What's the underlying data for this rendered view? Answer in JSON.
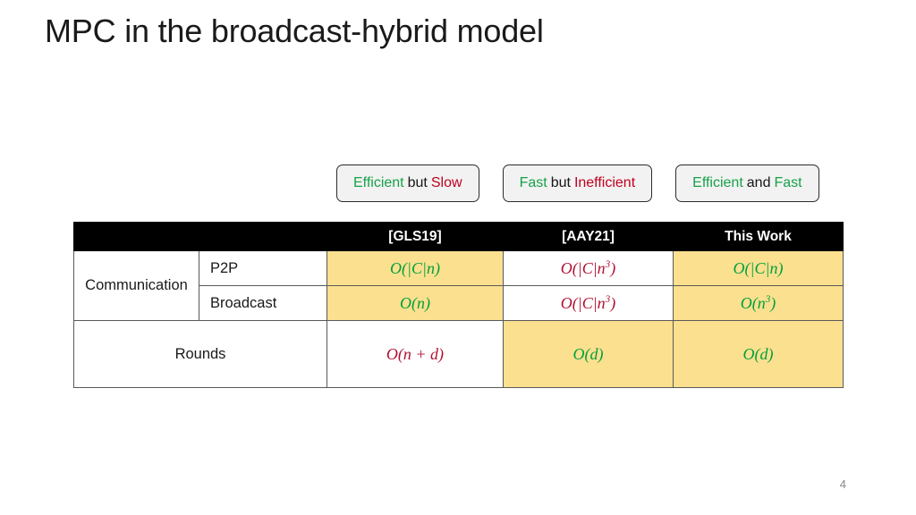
{
  "slide": {
    "title": "MPC in the broadcast-hybrid model",
    "number": "4"
  },
  "colors": {
    "green": "#17a14a",
    "red": "#c00020",
    "black": "#161616",
    "math_green": "#00a03c",
    "math_red": "#b01030",
    "highlight": "#fbe08f",
    "header_bg": "#000000",
    "badge_bg": "#f2f2f2"
  },
  "badges": [
    {
      "part1": "Efficient",
      "part1_color": "green",
      "part2": "but",
      "part2_color": "black",
      "part3": "Slow",
      "part3_color": "red"
    },
    {
      "part1": "Fast",
      "part1_color": "green",
      "part2": "but",
      "part2_color": "black",
      "part3": "Inefficient",
      "part3_color": "red"
    },
    {
      "part1": "Efficient",
      "part1_color": "green",
      "part2": "and",
      "part2_color": "black",
      "part3": "Fast",
      "part3_color": "green"
    }
  ],
  "table": {
    "headers": [
      "",
      "",
      "[GLS19]",
      "[AAY21]",
      "This Work"
    ],
    "row_groups": [
      {
        "label": "Communication",
        "subrows": [
          {
            "sublabel": "P2P",
            "cells": [
              {
                "text": "O(|C|n)",
                "sup": "",
                "color": "math_green",
                "highlight": true
              },
              {
                "text": "O(|C|n",
                "sup": "3",
                "color": "math_red",
                "highlight": false,
                "suffix": ")"
              },
              {
                "text": "O(|C|n)",
                "sup": "",
                "color": "math_green",
                "highlight": true
              }
            ]
          },
          {
            "sublabel": "Broadcast",
            "cells": [
              {
                "text": "O(n)",
                "sup": "",
                "color": "math_green",
                "highlight": true
              },
              {
                "text": "O(|C|n",
                "sup": "3",
                "color": "math_red",
                "highlight": false,
                "suffix": ")"
              },
              {
                "text": "O(n",
                "sup": "3",
                "color": "math_green",
                "highlight": true,
                "suffix": ")"
              }
            ]
          }
        ]
      },
      {
        "label": "Rounds",
        "subrows": [
          {
            "sublabel": "",
            "cells": [
              {
                "text": "O(n + d)",
                "sup": "",
                "color": "math_red",
                "highlight": false
              },
              {
                "text": "O(d)",
                "sup": "",
                "color": "math_green",
                "highlight": true
              },
              {
                "text": "O(d)",
                "sup": "",
                "color": "math_green",
                "highlight": true
              }
            ]
          }
        ]
      }
    ]
  }
}
